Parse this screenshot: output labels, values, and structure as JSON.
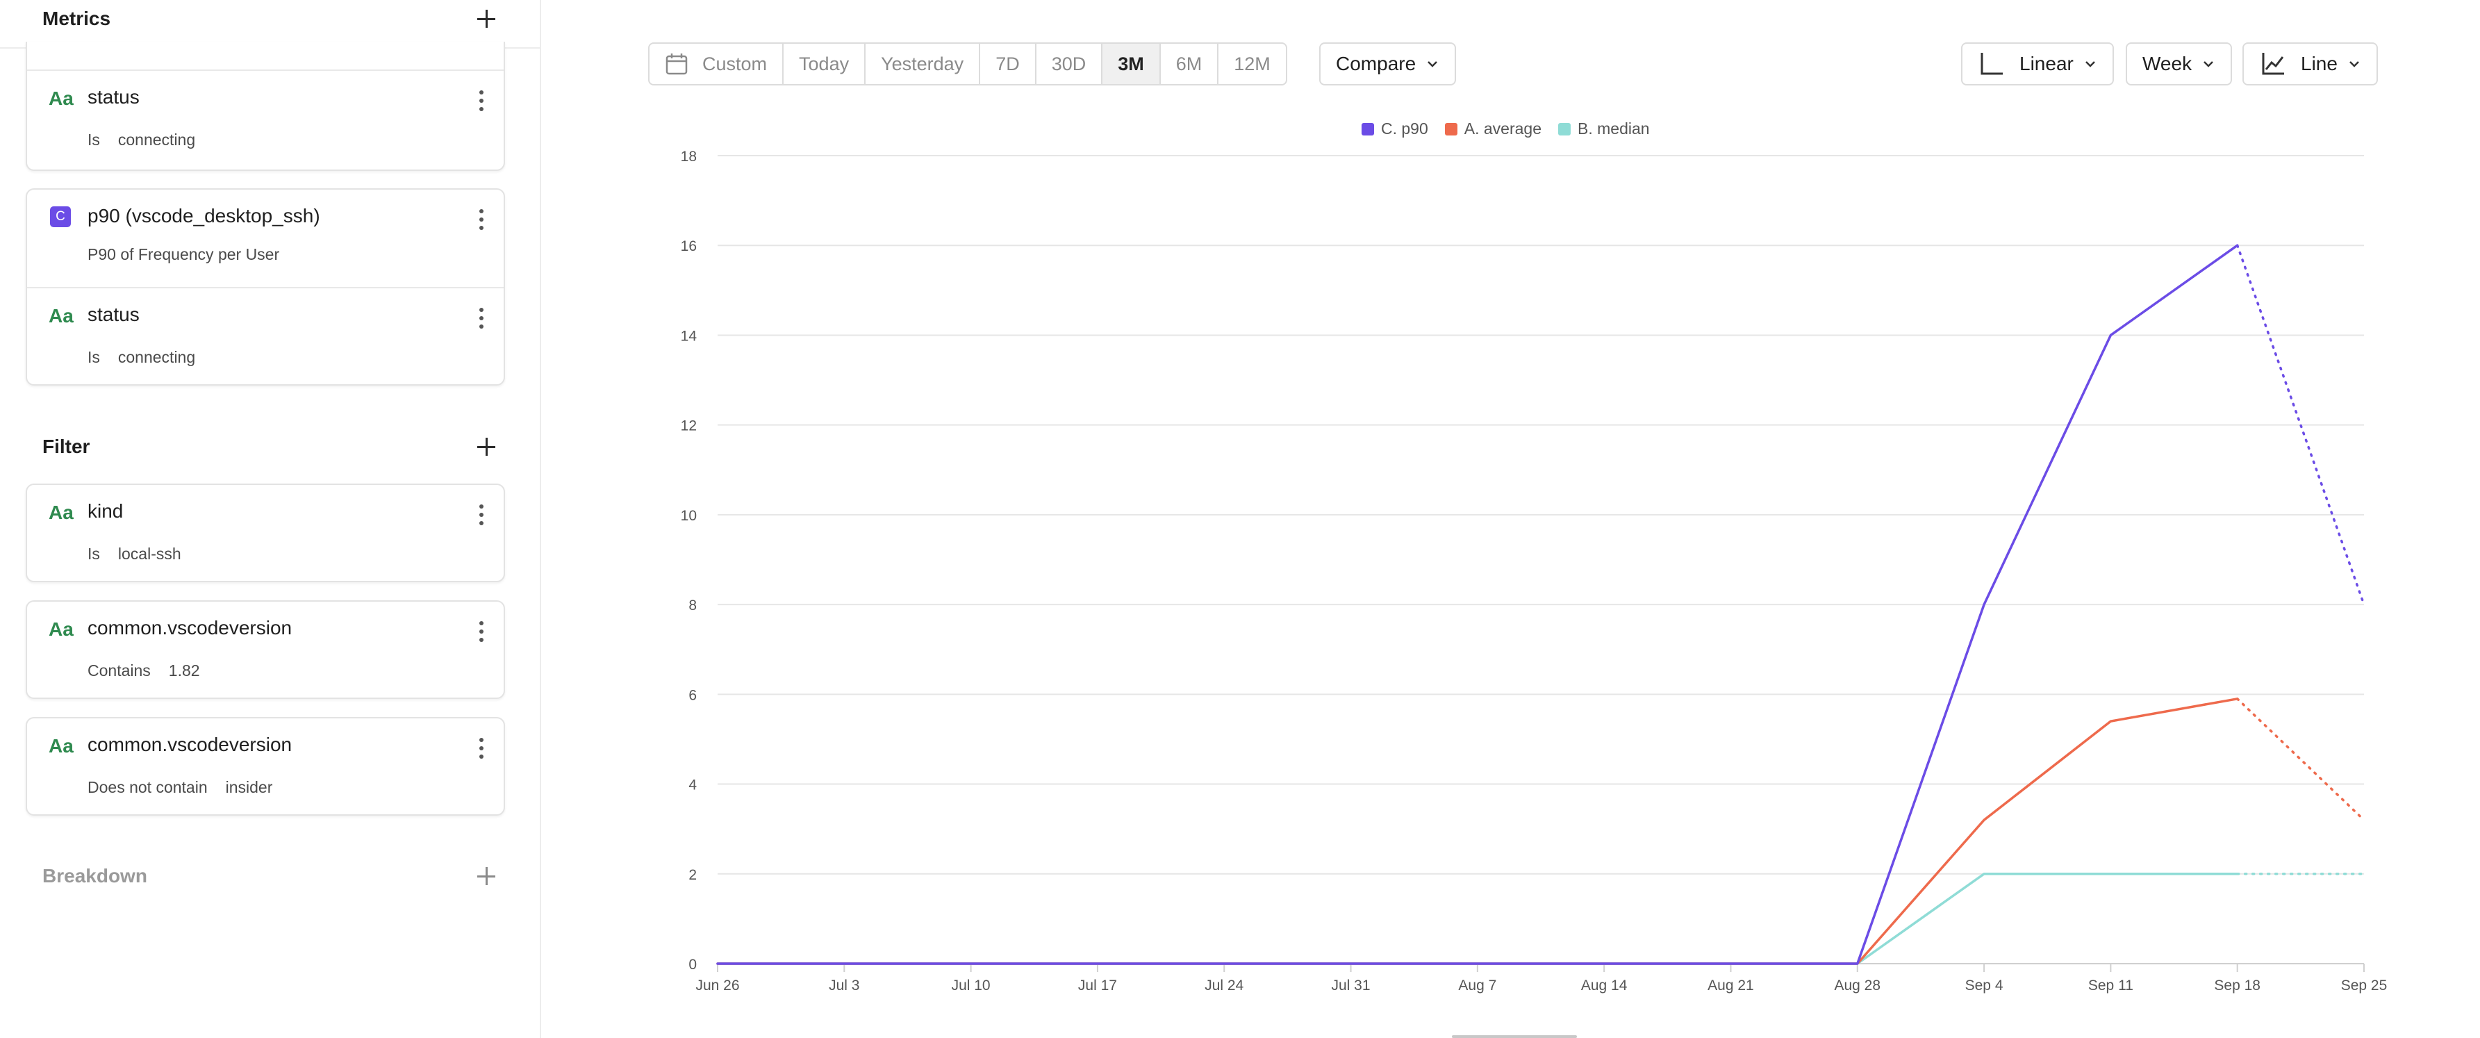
{
  "sidebar": {
    "metrics_title": "Metrics",
    "metric_cards": [
      {
        "rows": [
          {
            "type": "Aa",
            "title": "status",
            "op": "Is",
            "value": "connecting"
          }
        ]
      },
      {
        "rows": [
          {
            "type": "C",
            "title": "p90 (vscode_desktop_ssh)",
            "subtitle": "P90 of Frequency per User"
          },
          {
            "type": "Aa",
            "title": "status",
            "op": "Is",
            "value": "connecting"
          }
        ]
      }
    ],
    "filter_title": "Filter",
    "filters": [
      {
        "type": "Aa",
        "title": "kind",
        "op": "Is",
        "value": "local-ssh"
      },
      {
        "type": "Aa",
        "title": "common.vscodeversion",
        "op": "Contains",
        "value": "1.82"
      },
      {
        "type": "Aa",
        "title": "common.vscodeversion",
        "op": "Does not contain",
        "value": "insider"
      }
    ],
    "breakdown_title": "Breakdown"
  },
  "toolbar": {
    "date_ranges": [
      "Custom",
      "Today",
      "Yesterday",
      "7D",
      "30D",
      "3M",
      "6M",
      "12M"
    ],
    "active_range": "3M",
    "compare_label": "Compare",
    "scale_label": "Linear",
    "interval_label": "Week",
    "chart_type_label": "Line"
  },
  "chart_data": {
    "type": "line",
    "x": [
      "Jun 26",
      "Jul 3",
      "Jul 10",
      "Jul 17",
      "Jul 24",
      "Jul 31",
      "Aug 7",
      "Aug 14",
      "Aug 21",
      "Aug 28",
      "Sep 4",
      "Sep 11",
      "Sep 18",
      "Sep 25"
    ],
    "ylim": [
      0,
      18
    ],
    "yticks": [
      0,
      2,
      4,
      6,
      8,
      10,
      12,
      14,
      16,
      18
    ],
    "grid": true,
    "legend_position": "top-center",
    "incomplete_from_index": 12,
    "series": [
      {
        "name": "C. p90",
        "color": "#6b4ce6",
        "values": [
          0,
          0,
          0,
          0,
          0,
          0,
          0,
          0,
          0,
          0,
          8,
          14,
          16,
          8
        ]
      },
      {
        "name": "A. average",
        "color": "#ee6a4c",
        "values": [
          0,
          0,
          0,
          0,
          0,
          0,
          0,
          0,
          0,
          0,
          3.2,
          5.4,
          5.9,
          3.2
        ]
      },
      {
        "name": "B. median",
        "color": "#8fdcd6",
        "values": [
          0,
          0,
          0,
          0,
          0,
          0,
          0,
          0,
          0,
          0,
          2,
          2,
          2,
          2
        ]
      }
    ]
  }
}
